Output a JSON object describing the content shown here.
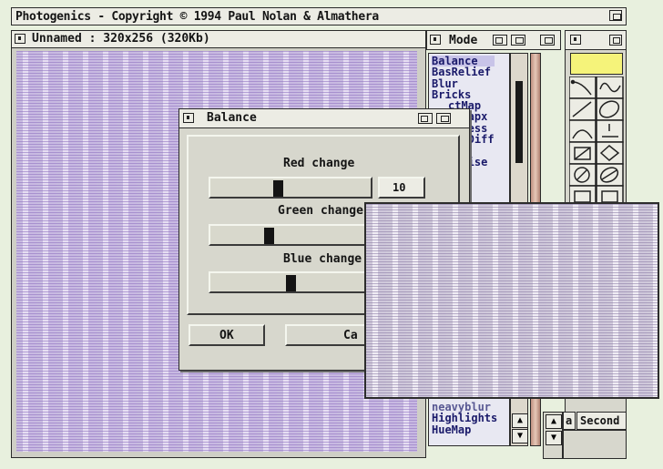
{
  "screen_title": "Photogenics - Copyright © 1994 Paul Nolan & Almathera",
  "image_window": {
    "title": "Unnamed : 320x256 (320Kb)"
  },
  "mode_panel": {
    "label": "Mode",
    "items": [
      "Balance",
      "BasRelief",
      "Blur",
      "Bricks",
      "ColMap",
      "ColMapx",
      "Contrast",
      "GammaDiff",
      "Layer",
      "Posterise",
      "HeavyBlur",
      "Highlights",
      "HueMap"
    ],
    "visible_partial": [
      "ctMap",
      "ctMapx",
      "ntness",
      "mmaDiff",
      "er",
      "turise",
      "neavyblur"
    ]
  },
  "balance_dialog": {
    "title": "Balance",
    "red_label": "Red change",
    "red_value": "10",
    "green_label": "Green change",
    "blue_label": "Blue change",
    "ok_label": "OK",
    "cancel_label": "Ca",
    "red_level": 0.42,
    "green_level": 0.36,
    "blue_level": 0.5
  },
  "right_panel": {
    "a_label": "a",
    "second_label": "Second"
  },
  "colors": {
    "accent": "#f5f37a",
    "purple": "#8a6cc0",
    "panel": "#d7d7cd"
  }
}
